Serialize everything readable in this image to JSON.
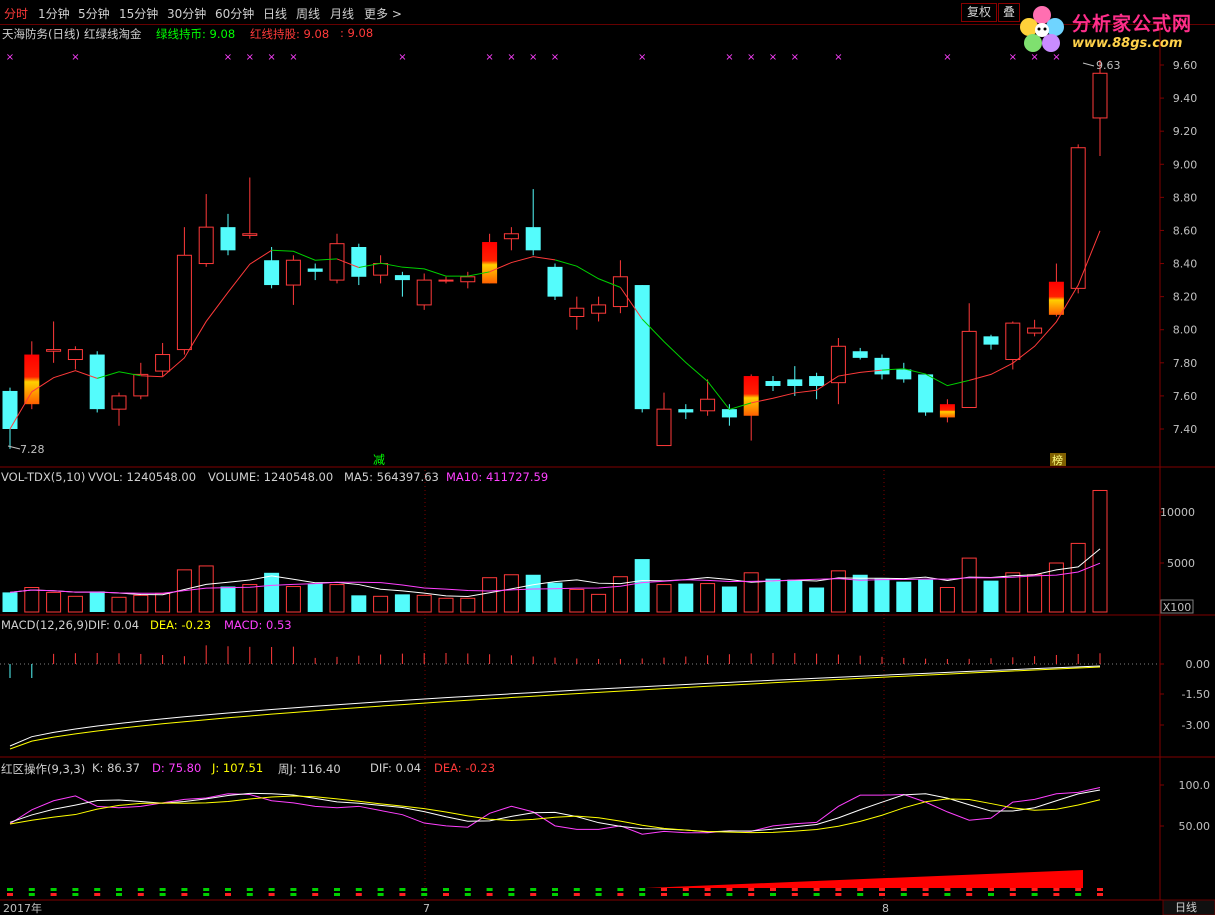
{
  "toolbar": {
    "periods": [
      "分时",
      "1分钟",
      "5分钟",
      "15分钟",
      "30分钟",
      "60分钟",
      "日线",
      "周线",
      "月线",
      "更多 >"
    ],
    "fuquan_label": "复权",
    "overlay_label": "叠"
  },
  "logo": {
    "title": "分析家公式网",
    "url": "www.88gs.com"
  },
  "main_panel": {
    "stock_title": "天海防务(日线)",
    "indicator_name": "红绿线淘金",
    "green_line_label": "绿线持币: 9.08",
    "red_line_label": "红线持股: 9.08",
    "extra_value": ": 9.08",
    "price_axis": [
      "9.60",
      "9.40",
      "9.20",
      "9.00",
      "8.80",
      "8.60",
      "8.40",
      "8.20",
      "8.00",
      "7.80",
      "7.60",
      "7.40"
    ],
    "high_marker": "9.63",
    "low_marker": "7.28",
    "event_reduce": "减",
    "event_other": "榜"
  },
  "volume_panel": {
    "title": "VOL-TDX(5,10)",
    "vvol": "VVOL: 1240548.00",
    "volume": "VOLUME: 1240548.00",
    "ma5": "MA5: 564397.63",
    "ma10": "MA10: 411727.59",
    "axis": [
      "10000",
      "5000"
    ],
    "unit": "X100"
  },
  "macd_panel": {
    "title": "MACD(12,26,9)",
    "dif": "DIF: 0.04",
    "dea": "DEA: -0.23",
    "macd": "MACD: 0.53",
    "axis": [
      "0.00",
      "-1.50",
      "-3.00"
    ]
  },
  "kdj_panel": {
    "title": "红区操作(9,3,3)",
    "k": "K: 86.37",
    "d": "D: 75.80",
    "j": "J: 107.51",
    "weekj": "周J: 116.40",
    "dif": "DIF: 0.04",
    "dea": "DEA: -0.23",
    "axis": [
      "100.0",
      "50.00"
    ]
  },
  "bottom_axis": {
    "year": "2017年",
    "m7": "7",
    "m8": "8",
    "period_button": "日线"
  },
  "colors": {
    "up": "#ff3a3a",
    "down": "#54fcfc",
    "green_line": "#00d000",
    "grid": "#800000",
    "magenta": "#ff40ff",
    "yellow": "#ffff00"
  },
  "chart_data": {
    "type": "candlestick",
    "candles": [
      [
        7.63,
        7.4,
        7.65,
        7.28
      ],
      [
        7.55,
        7.85,
        7.93,
        7.52
      ],
      [
        7.87,
        7.88,
        8.05,
        7.8
      ],
      [
        7.82,
        7.88,
        7.9,
        7.76
      ],
      [
        7.85,
        7.52,
        7.87,
        7.5
      ],
      [
        7.52,
        7.6,
        7.62,
        7.42
      ],
      [
        7.6,
        7.73,
        7.8,
        7.58
      ],
      [
        7.75,
        7.85,
        7.92,
        7.72
      ],
      [
        7.88,
        8.45,
        8.62,
        7.85
      ],
      [
        8.4,
        8.62,
        8.82,
        8.38
      ],
      [
        8.62,
        8.48,
        8.7,
        8.45
      ],
      [
        8.57,
        8.58,
        8.92,
        8.55
      ],
      [
        8.42,
        8.27,
        8.5,
        8.25
      ],
      [
        8.27,
        8.42,
        8.45,
        8.15
      ],
      [
        8.37,
        8.35,
        8.4,
        8.3
      ],
      [
        8.3,
        8.52,
        8.58,
        8.28
      ],
      [
        8.5,
        8.32,
        8.52,
        8.27
      ],
      [
        8.33,
        8.4,
        8.45,
        8.28
      ],
      [
        8.33,
        8.3,
        8.35,
        8.2
      ],
      [
        8.15,
        8.3,
        8.34,
        8.12
      ],
      [
        8.3,
        8.3,
        8.32,
        8.28
      ],
      [
        8.29,
        8.32,
        8.35,
        8.25
      ],
      [
        8.28,
        8.53,
        8.58,
        8.28
      ],
      [
        8.55,
        8.58,
        8.62,
        8.48
      ],
      [
        8.62,
        8.48,
        8.85,
        8.45
      ],
      [
        8.38,
        8.2,
        8.4,
        8.18
      ],
      [
        8.08,
        8.13,
        8.2,
        8.0
      ],
      [
        8.1,
        8.15,
        8.2,
        8.05
      ],
      [
        8.14,
        8.32,
        8.42,
        8.1
      ],
      [
        8.27,
        7.52,
        8.27,
        7.5
      ],
      [
        7.3,
        7.52,
        7.62,
        7.3
      ],
      [
        7.52,
        7.5,
        7.55,
        7.46
      ],
      [
        7.51,
        7.58,
        7.7,
        7.48
      ],
      [
        7.52,
        7.47,
        7.55,
        7.42
      ],
      [
        7.48,
        7.72,
        7.73,
        7.33
      ],
      [
        7.69,
        7.66,
        7.72,
        7.63
      ],
      [
        7.7,
        7.66,
        7.78,
        7.6
      ],
      [
        7.72,
        7.66,
        7.74,
        7.58
      ],
      [
        7.68,
        7.9,
        7.95,
        7.55
      ],
      [
        7.87,
        7.83,
        7.89,
        7.82
      ],
      [
        7.83,
        7.73,
        7.85,
        7.7
      ],
      [
        7.76,
        7.7,
        7.8,
        7.68
      ],
      [
        7.73,
        7.5,
        7.73,
        7.48
      ],
      [
        7.47,
        7.55,
        7.58,
        7.44
      ],
      [
        7.53,
        7.99,
        8.16,
        7.53
      ],
      [
        7.96,
        7.91,
        7.97,
        7.88
      ],
      [
        7.82,
        8.04,
        8.05,
        7.76
      ],
      [
        7.98,
        8.01,
        8.06,
        7.96
      ],
      [
        8.09,
        8.29,
        8.4,
        8.08
      ],
      [
        8.25,
        9.1,
        9.12,
        8.22
      ],
      [
        9.28,
        9.55,
        9.63,
        9.05
      ]
    ],
    "special_bars": [
      1,
      22,
      34,
      43,
      48
    ],
    "volume": [
      2.0,
      2.5,
      2.0,
      1.6,
      2.1,
      1.5,
      1.7,
      1.9,
      4.3,
      4.7,
      2.6,
      2.8,
      4.0,
      2.6,
      2.9,
      2.8,
      1.7,
      1.6,
      1.8,
      1.7,
      1.4,
      1.4,
      3.5,
      3.8,
      3.8,
      3.0,
      2.3,
      1.8,
      3.6,
      5.4,
      2.8,
      2.9,
      2.9,
      2.6,
      4.0,
      3.4,
      3.3,
      2.5,
      4.2,
      3.8,
      3.4,
      3.1,
      3.3,
      2.5,
      5.5,
      3.2,
      4.0,
      3.8,
      5.0,
      7.0,
      12.4
    ],
    "x_axis_labels": [
      "2017年",
      "7",
      "8"
    ]
  }
}
